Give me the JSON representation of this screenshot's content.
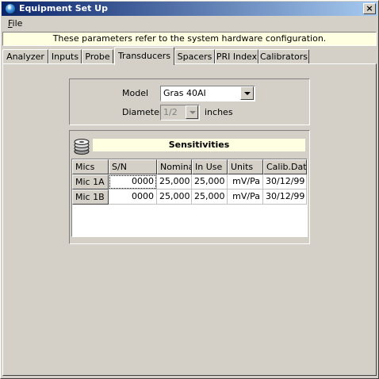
{
  "window": {
    "title": "Equipment Set Up",
    "close_symbol": "×"
  },
  "menu": {
    "file_hotkey": "F",
    "file_rest": "ile"
  },
  "banner": {
    "text": "These parameters refer to the system hardware configuration."
  },
  "tabs": [
    {
      "label": "Analyzer"
    },
    {
      "label": "Inputs"
    },
    {
      "label": "Probe"
    },
    {
      "label": "Transducers",
      "active": true
    },
    {
      "label": "Spacers"
    },
    {
      "label": "PRI Index"
    },
    {
      "label": "Calibrators"
    }
  ],
  "model": {
    "label": "Model",
    "value": "Gras 40AI"
  },
  "diameter": {
    "label": "Diameter",
    "value": "1/2",
    "unit": "inches",
    "enabled": false
  },
  "sensitivities": {
    "title": "Sensitivities",
    "icon": "stacked-discs-icon",
    "columns": [
      "Mics",
      "S/N",
      "Nominal",
      "In Use",
      "Units",
      "Calib.Date"
    ],
    "rows": [
      {
        "mic": "Mic 1A",
        "sn": "0000",
        "nominal": "25,000",
        "in_use": "25,000",
        "units": "mV/Pa",
        "calib_date": "30/12/99"
      },
      {
        "mic": "Mic 1B",
        "sn": "0000",
        "nominal": "25,000",
        "in_use": "25,000",
        "units": "mV/Pa",
        "calib_date": "30/12/99"
      }
    ]
  },
  "colors": {
    "titlebar_start": "#0a246a",
    "titlebar_end": "#a6caf0",
    "face": "#d4d0c8",
    "info_background": "#ffffe1"
  }
}
